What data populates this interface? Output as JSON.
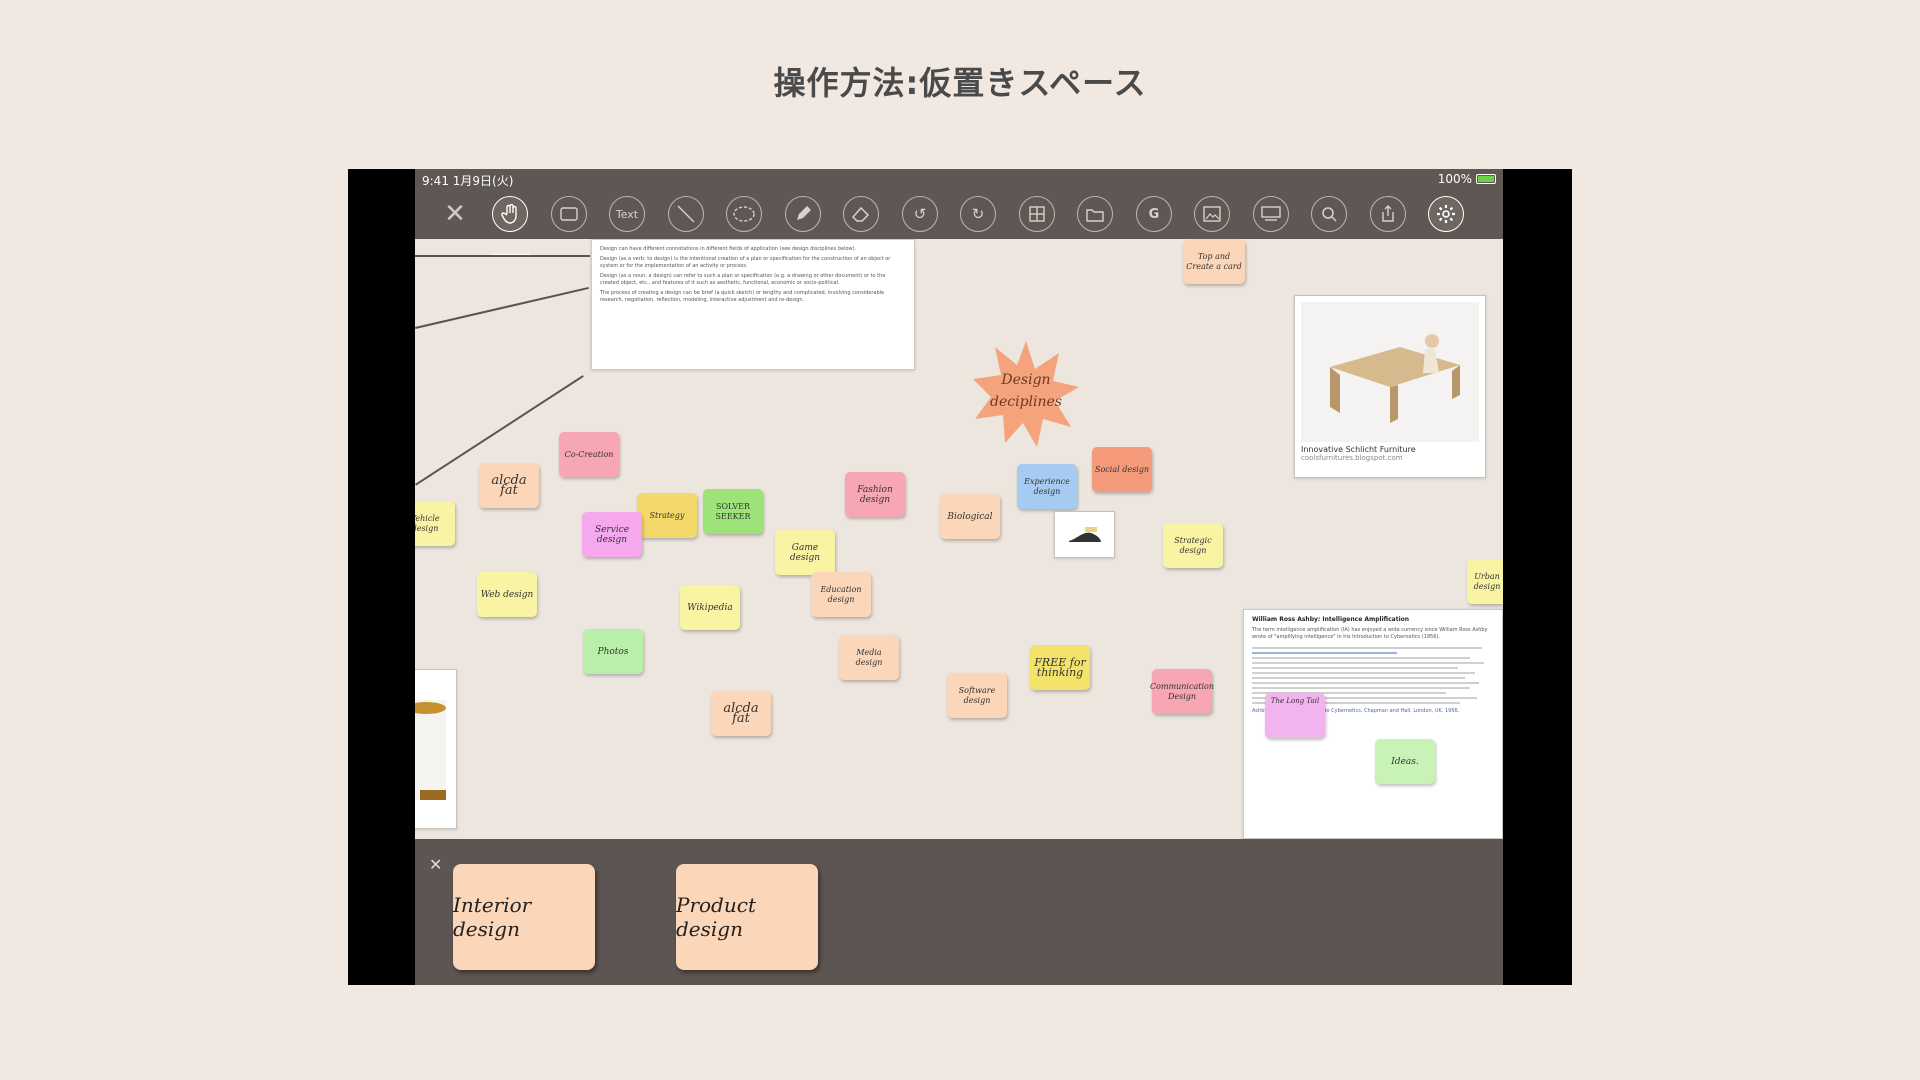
{
  "slide": {
    "title": "操作方法:仮置きスペース"
  },
  "statusbar": {
    "time": "9:41  1月9日(火)",
    "battery": "100%"
  },
  "toolbar": {
    "close_icon": "close-icon",
    "text_tool_label": "Text",
    "group_tool_label": "G",
    "tools": [
      "hand-icon",
      "rectangle-icon",
      "text-icon",
      "line-icon",
      "lasso-icon",
      "pen-icon",
      "eraser-icon",
      "undo-icon",
      "redo-icon",
      "grid-icon",
      "folder-icon",
      "group-icon",
      "image-icon",
      "present-icon",
      "search-icon",
      "share-icon",
      "gear-icon"
    ]
  },
  "canvas": {
    "star": {
      "text": "Design deciplines",
      "color": "#f4a37d"
    },
    "doc_top": {
      "paragraph1": "Design can have different connotations in different fields of application (see design disciplines below).",
      "paragraph2": "Design (as a verb: to design) is the intentional creation of a plan or specification for the construction of an object or system or for the implementation of an activity or process.",
      "paragraph3": "Design (as a noun: a design) can refer to such a plan or specification (e.g. a drawing or other document) or to the created object, etc., and features of it such as aesthetic, functional, economic or socio-political.",
      "paragraph4": "The process of creating a design can be brief (a quick sketch) or lengthy and complicated, involving considerable research, negotiation, reflection, modeling, interactive adjustment and re-design."
    },
    "furniture_card": {
      "caption": "Innovative Schlicht Furniture",
      "source": "coolsfurnitures.blogspot.com"
    },
    "doc_right": {
      "title": "William Ross Ashby: Intelligence Amplification",
      "body": "The term intelligence amplification (IA) has enjoyed a wide currency since William Ross Ashby wrote of \"amplifying intelligence\" in his Introduction to Cybernetics (1956).",
      "citation": "Ashby, W.R., An Introduction to Cybernetics, Chapman and Hall, London, UK, 1956."
    },
    "notes": [
      {
        "text": "Top and Create a card",
        "color": "#fbd6b8"
      },
      {
        "text": "Co-Creation",
        "color": "#f7a6b4"
      },
      {
        "text": "alcda fat",
        "color": "#fbd6b8"
      },
      {
        "text": "Strategy",
        "color": "#f4d96a"
      },
      {
        "text": "SOLVER SEEKER",
        "color": "#9ee27a"
      },
      {
        "text": "Service design",
        "color": "#f6a8ef"
      },
      {
        "text": "Fashion design",
        "color": "#f7a6b4"
      },
      {
        "text": "Biological",
        "color": "#fbd6b8"
      },
      {
        "text": "Experience design",
        "color": "#a5cbf1"
      },
      {
        "text": "Social design",
        "color": "#f59a7a"
      },
      {
        "text": "Strategic design",
        "color": "#f9f4a3"
      },
      {
        "text": "Game design",
        "color": "#f9f4a3"
      },
      {
        "text": "Education design",
        "color": "#fbd6b8"
      },
      {
        "text": "Web design",
        "color": "#f9f4a3"
      },
      {
        "text": "Wikipedia",
        "color": "#f9f4a3"
      },
      {
        "text": "Photos",
        "color": "#b8efa9"
      },
      {
        "text": "Media design",
        "color": "#fbd6b8"
      },
      {
        "text": "FREE for thinking",
        "color": "#f4e36a"
      },
      {
        "text": "Software design",
        "color": "#fbd6b8"
      },
      {
        "text": "Communication Design",
        "color": "#f7a6b4"
      },
      {
        "text": "alcda fat",
        "color": "#fbd6b8"
      },
      {
        "text": "Ideas.",
        "color": "#c9f2b7"
      },
      {
        "text": "The Long Tail",
        "color": "#f2b4ee"
      },
      {
        "text": "Urban design",
        "color": "#f9f4a3"
      },
      {
        "text": "Vehicle design",
        "color": "#f9f4a3"
      }
    ]
  },
  "tray": {
    "close_icon": "close-icon",
    "items": [
      {
        "text": "Interior design"
      },
      {
        "text": "Product design"
      }
    ]
  }
}
